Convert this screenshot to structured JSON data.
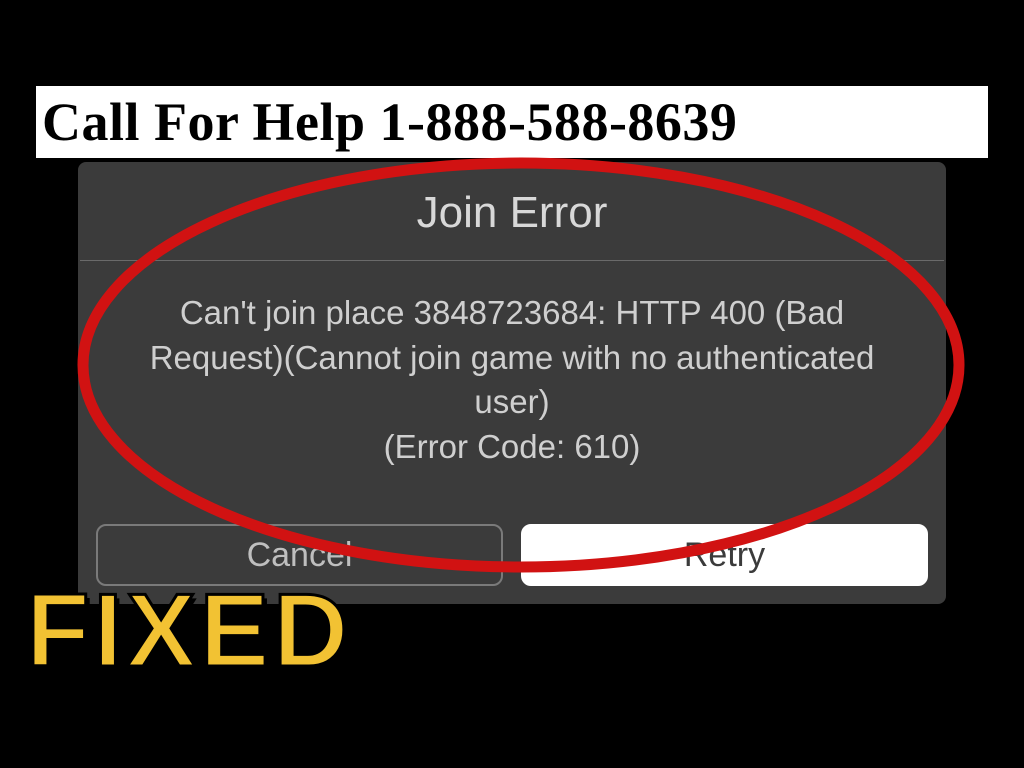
{
  "banner": {
    "text": "Call For Help 1-888-588-8639"
  },
  "dialog": {
    "title": "Join Error",
    "message_line1": "Can't join place 3848723684: HTTP 400 (Bad",
    "message_line2": "Request)(Cannot join game with no authenticated",
    "message_line3": "user)",
    "message_line4": "(Error Code: 610)",
    "cancel_label": "Cancel",
    "retry_label": "Retry"
  },
  "overlay": {
    "fixed_label": "FIXED"
  }
}
